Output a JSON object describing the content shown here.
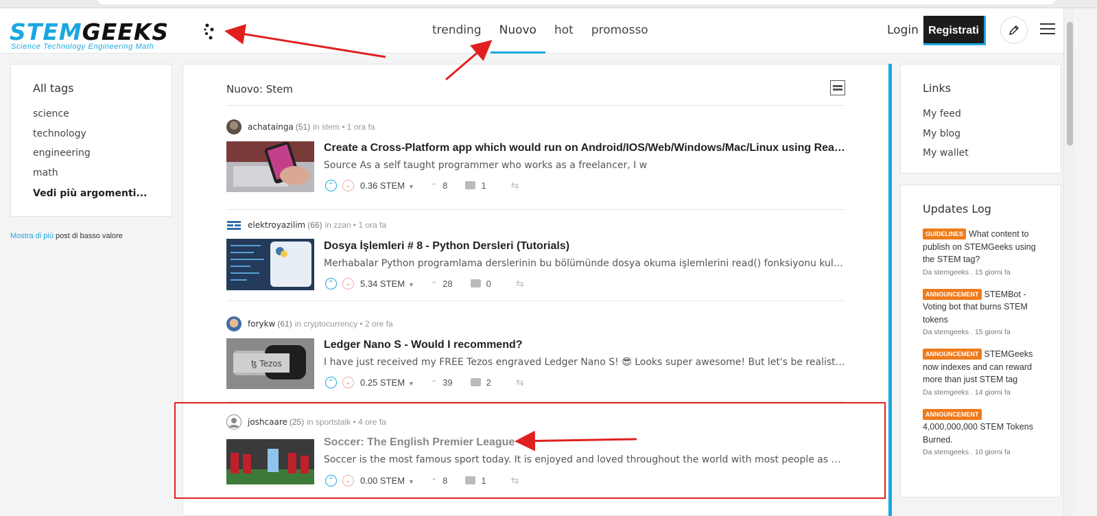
{
  "header": {
    "logo": {
      "main_left": "STEM",
      "main_right": "GEEKS",
      "sub": "Science Technology Engineering Math"
    },
    "nav": [
      {
        "label": "trending",
        "active": false
      },
      {
        "label": "Nuovo",
        "active": true
      },
      {
        "label": "hot",
        "active": false
      },
      {
        "label": "promosso",
        "active": false
      }
    ],
    "login_label": "Login",
    "register_label": "Registrati",
    "icons": {
      "edit": "pencil-icon",
      "menu": "hamburger-menu-icon"
    }
  },
  "left_sidebar": {
    "title": "All tags",
    "tags": [
      "science",
      "technology",
      "engineering",
      "math"
    ],
    "more_label": "Vedi più argomenti...",
    "low_value_link": "Mostra di più",
    "low_value_text": " post di basso valore"
  },
  "main": {
    "title": "Nuovo: Stem",
    "posts": [
      {
        "author": "achatainga",
        "rep": "(51)",
        "meta": "in stem • 1 ora fa",
        "title": "Create a Cross-Platform app which would run on Android/IOS/Web/Windows/Mac/Linux using React Native",
        "summary": "Source As a self taught programmer who works as a freelancer, I w",
        "payout": "0.36 STEM",
        "votes": "8",
        "comments": "1",
        "visited": false
      },
      {
        "author": "elektroyazilim",
        "rep": "(66)",
        "meta": "in zzan • 1 ora fa",
        "title": "Dosya İşlemleri # 8 - Python Dersleri (Tutorials)",
        "summary": "Merhabalar Python programlama derslerinin bu bölümünde dosya okuma işlemlerini read() fonksiyonu kullanarak yapacağız",
        "payout": "5.34 STEM",
        "votes": "28",
        "comments": "0",
        "visited": false
      },
      {
        "author": "forykw",
        "rep": "(61)",
        "meta": "in cryptocurrency • 2 ore fa",
        "title": "Ledger Nano S - Would I recommend?",
        "summary": "I have just received my FREE Tezos engraved Ledger Nano S! 😎 Looks super awesome! But let's be realistic......",
        "payout": "0.25 STEM",
        "votes": "39",
        "comments": "2",
        "visited": false
      },
      {
        "author": "joshcaare",
        "rep": "(25)",
        "meta": "in sportstalk • 4 ore fa",
        "title": "Soccer:  The English Premier League",
        "summary": "Soccer is the most famous sport today. It is enjoyed and loved throughout the world with most people as soccer fans",
        "payout": "0.00 STEM",
        "votes": "8",
        "comments": "1",
        "visited": true
      }
    ]
  },
  "right_sidebar": {
    "links_title": "Links",
    "links": [
      "My feed",
      "My blog",
      "My wallet"
    ],
    "updates_title": "Updates Log",
    "updates": [
      {
        "badge": "GUIDELINES",
        "text": "What content to publish on STEMGeeks using the STEM tag?",
        "by": "Da stemgeeks . 15 giorni fa"
      },
      {
        "badge": "ANNOUNCEMENT",
        "text": "STEMBot - Voting bot that burns STEM tokens",
        "by": "Da stemgeeks . 15 giorni fa"
      },
      {
        "badge": "ANNOUNCEMENT",
        "text": "STEMGeeks now indexes and can reward more than just STEM tag",
        "by": "Da stemgeeks . 14 giorni fa"
      },
      {
        "badge": "ANNOUNCEMENT",
        "text": "4,000,000,000 STEM Tokens Burned.",
        "by": "Da stemgeeks . 10 giorni fa"
      }
    ]
  },
  "colors": {
    "accent": "#1aa7e0",
    "badge": "#f07a1a",
    "annotation": "#e02020"
  }
}
